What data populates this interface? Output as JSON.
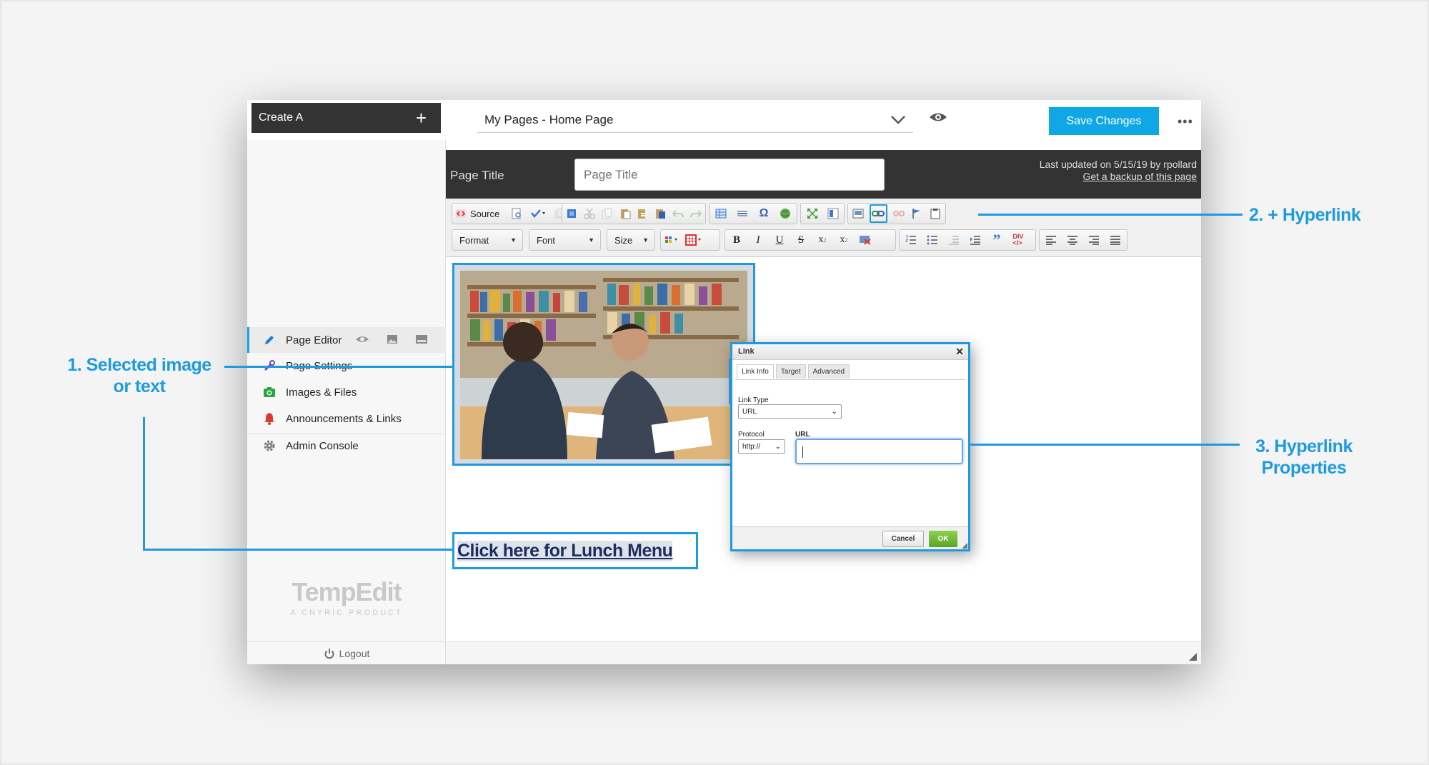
{
  "create": {
    "label": "Create A",
    "plus": "+"
  },
  "page_select": {
    "value": "My Pages - Home Page"
  },
  "save_button": "Save Changes",
  "more_menu": "•••",
  "sidebar": {
    "items": [
      {
        "label": "Page Editor",
        "icon": "pencil-icon",
        "color": "#1e7fcf"
      },
      {
        "label": "Page Settings",
        "icon": "wrench-icon",
        "color": "#7b3fc7"
      },
      {
        "label": "Images & Files",
        "icon": "camera-icon",
        "color": "#2aa53a"
      },
      {
        "label": "Announcements & Links",
        "icon": "bell-icon",
        "color": "#d93c2f"
      },
      {
        "label": "Admin Console",
        "icon": "gear-icon",
        "color": "#777777"
      }
    ],
    "logo": "TempEdit",
    "logo_sub": "A CNYRIC PRODUCT",
    "logout": "Logout"
  },
  "title_bar": {
    "label": "Page Title",
    "input_placeholder": "Page Title",
    "updated": "Last updated on 5/15/19 by rpollard",
    "backup_link": "Get a backup of this page"
  },
  "toolbar": {
    "source": "Source",
    "combos": [
      "Format",
      "Font",
      "Size"
    ]
  },
  "content": {
    "link_text": "Click here for Lunch Menu"
  },
  "link_dialog": {
    "title": "Link",
    "close": "✕",
    "tabs": [
      "Link Info",
      "Target",
      "Advanced"
    ],
    "link_type_label": "Link Type",
    "link_type_value": "URL",
    "protocol_label": "Protocol",
    "protocol_value": "http://",
    "url_label": "URL",
    "url_value": "",
    "cancel": "Cancel",
    "ok": "OK"
  },
  "callouts": {
    "c1_line1": "1. Selected image",
    "c1_line2": "or text",
    "c2": "2. + Hyperlink",
    "c3_line1": "3. Hyperlink",
    "c3_line2": "Properties"
  },
  "colors": {
    "accent": "#1e9be0",
    "save": "#0fa7e6",
    "dark": "#333333",
    "ok": "#6cbf2e"
  }
}
